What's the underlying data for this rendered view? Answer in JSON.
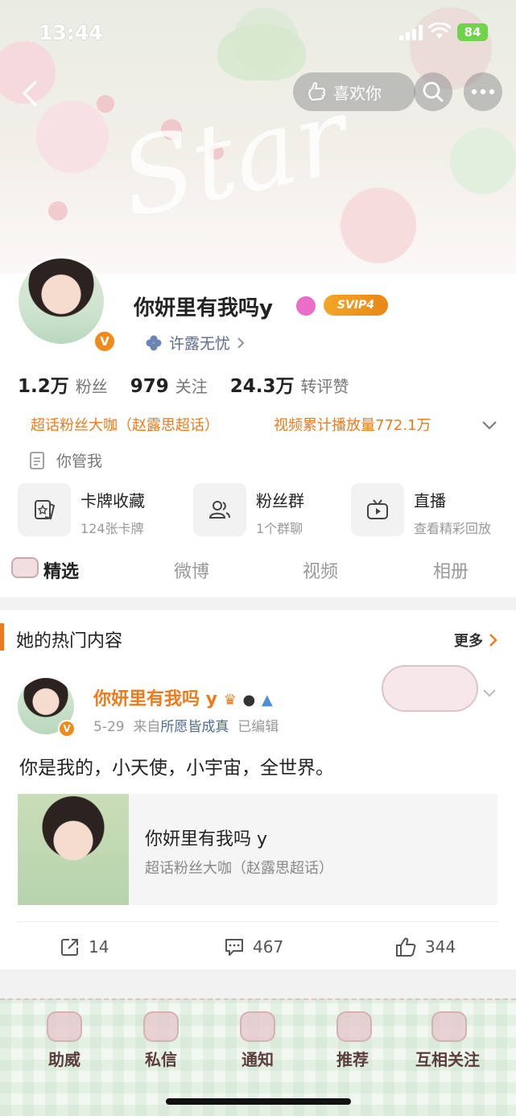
{
  "status_bar": {
    "time": "13:44",
    "battery": "84"
  },
  "header": {
    "like_label": "喜欢你",
    "banner_text": "Star",
    "colors": {
      "accent": "#ef7a1a",
      "vip": "#f3a626",
      "link": "#5c6b8a"
    }
  },
  "profile": {
    "nickname": "你妍里有我吗y",
    "verified_badge": "V",
    "vip_badge": "SVIP4",
    "group_link": "许露无忧",
    "stats": [
      {
        "value": "1.2万",
        "label": "粉丝"
      },
      {
        "value": "979",
        "label": "关注"
      },
      {
        "value": "24.3万",
        "label": "转评赞"
      }
    ],
    "honor_1": "超话粉丝大咖（赵露思超话）",
    "honor_2": "视频累计播放量772.1万",
    "bio": "你管我"
  },
  "features": [
    {
      "title": "卡牌收藏",
      "subtitle": "124张卡牌",
      "icon": "card-icon"
    },
    {
      "title": "粉丝群",
      "subtitle": "1个群聊",
      "icon": "group-icon"
    },
    {
      "title": "直播",
      "subtitle": "查看精彩回放",
      "icon": "tv-icon"
    }
  ],
  "tabs": [
    "精选",
    "微博",
    "视频",
    "相册"
  ],
  "section": {
    "title": "她的热门内容",
    "more": "更多"
  },
  "post": {
    "author": "你妍里有我吗 y",
    "date": "5-29",
    "from_prefix": "来自",
    "source": "所愿皆成真",
    "edited": "已编辑",
    "text": "你是我的，小天使，小宇宙，全世界。",
    "card_title": "你妍里有我吗 y",
    "card_subtitle": "超话粉丝大咖（赵露思超话）",
    "reposts": "14",
    "comments": "467",
    "likes": "344"
  },
  "bottom_bar": [
    "助威",
    "私信",
    "通知",
    "推荐",
    "互相关注"
  ]
}
